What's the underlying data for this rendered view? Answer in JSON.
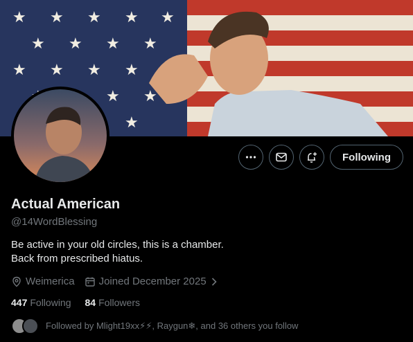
{
  "profile": {
    "display_name": "Actual American",
    "handle": "@14WordBlessing",
    "bio_line1": "Be active in your old circles, this is a chamber.",
    "bio_line2": "Back from prescribed hiatus.",
    "location": "Weimerica",
    "joined": "Joined December 2025"
  },
  "actions": {
    "follow_label": "Following",
    "more_icon": "more-icon",
    "message_icon": "envelope-icon",
    "notify_icon": "bell-plus-icon"
  },
  "stats": {
    "following_count": "447",
    "following_label": "Following",
    "followers_count": "84",
    "followers_label": "Followers"
  },
  "followed_by": {
    "text": "Followed by Mlight19xx⚡⚡, Raygun❄, and 36 others you follow"
  },
  "colors": {
    "background": "#000000",
    "text_primary": "#e7e9ea",
    "text_secondary": "#71767b",
    "button_border": "#536471"
  }
}
